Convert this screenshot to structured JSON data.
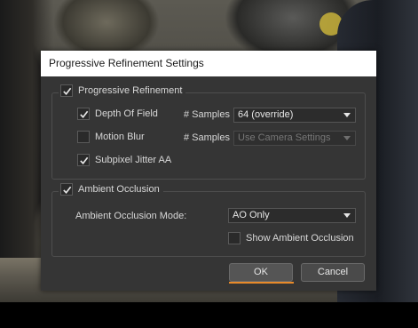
{
  "dialog": {
    "title": "Progressive Refinement Settings",
    "progressive": {
      "label": "Progressive Refinement",
      "checked": true,
      "dof": {
        "label": "Depth Of Field",
        "checked": true,
        "samples_label": "# Samples",
        "samples_value": "64 (override)"
      },
      "motion_blur": {
        "label": "Motion Blur",
        "checked": false,
        "samples_label": "# Samples",
        "samples_value": "Use Camera Settings"
      },
      "subpixel": {
        "label": "Subpixel Jitter AA",
        "checked": true
      }
    },
    "ambient": {
      "label": "Ambient Occlusion",
      "checked": true,
      "mode_label": "Ambient Occlusion Mode:",
      "mode_value": "AO Only",
      "show_label": "Show Ambient Occlusion",
      "show_checked": false
    },
    "buttons": {
      "ok": "OK",
      "cancel": "Cancel"
    },
    "colors": {
      "accent": "#e88a2a",
      "dialog_bg": "#353535",
      "title_bg": "#ffffff"
    }
  }
}
